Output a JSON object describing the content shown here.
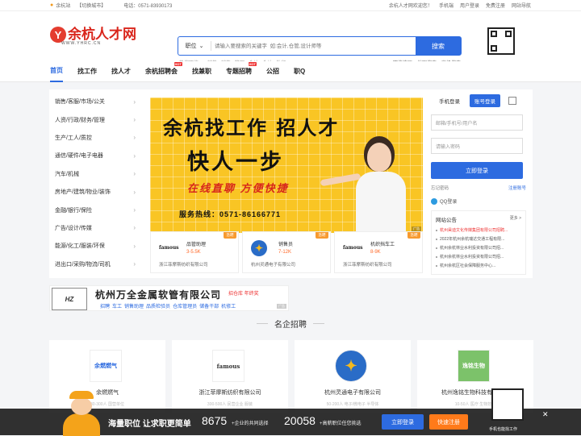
{
  "topbar": {
    "city": "余杭站",
    "switch": "【切换城市】",
    "phone": "电话：0571-83930173",
    "welcome": "余杭人才网欢迎您！",
    "mobile": "手机端",
    "login": "用户登录",
    "register": "免费注册",
    "sitenav": "网站导航"
  },
  "logo": {
    "text": "余杭人才网",
    "url": "WWW.YHRC.CN"
  },
  "search": {
    "type": "职位",
    "placeholder": "请输入要搜索的关键字  如:会计,仓管,设计师等",
    "button": "搜索",
    "hot_label": "热搜职位：",
    "hot": [
      "销售",
      "销售",
      "管理",
      "会计",
      "会计",
      "外贸"
    ],
    "quick": [
      "职位速历",
      "地图搜索",
      "高级搜索"
    ]
  },
  "nav": [
    {
      "label": "首页"
    },
    {
      "label": "找工作"
    },
    {
      "label": "找人才"
    },
    {
      "label": "余杭招聘会",
      "badge": "HOT"
    },
    {
      "label": "找兼职"
    },
    {
      "label": "专题招聘",
      "badge": "HOT"
    },
    {
      "label": "公招"
    },
    {
      "label": "职Q"
    }
  ],
  "cats": [
    "销售/客服/市场/公关",
    "人资/行政/财务/管理",
    "生产/工人/质控",
    "通信/硬件/电子电器",
    "汽车/机械",
    "房地产/建筑/物业/装饰",
    "金融/银行/保险",
    "广告/设计/传媒",
    "能源/化工/服装/环保",
    "进出口/采购/物流/司机"
  ],
  "banner": {
    "l1": "余杭找工作 招人才",
    "l2": "快人一步",
    "l3": "在线直聊 方便快捷",
    "l4": "服务热线：0571-86166771",
    "tag": "广告"
  },
  "jobs": [
    {
      "logo": "famous",
      "title": "品管助理",
      "salary": "3-5.5K",
      "company": "浙江菲摩斯纺织有限公司",
      "hot": "急聘"
    },
    {
      "logo": "✦",
      "title": "销售员",
      "salary": "7-12K",
      "company": "杭州灵通电子有限公司",
      "hot": "急聘"
    },
    {
      "logo": "famous",
      "title": "机织挡车工",
      "salary": "8-9K",
      "company": "浙江菲摩斯纺织有限公司",
      "hot": "急聘"
    }
  ],
  "login": {
    "tab1": "手机登录",
    "tab2": "账号登录",
    "user_ph": "邮箱/手机号/用户名",
    "pwd_ph": "请输入密码",
    "submit": "立即登录",
    "forgot": "忘记密码",
    "reg": "注册账号",
    "qq": "QQ登录"
  },
  "notice": {
    "title": "网站公告",
    "more": "更多 >",
    "items": [
      "杭州昊迪文化传媒集团有限公司招聘...",
      "2022年杭州余杭瑞达交通工程有限...",
      "杭州余杭林业水利投资有限公司招...",
      "杭州余杭林业水利投资有限公司招...",
      "杭州余杭区社会保障服务中心..."
    ]
  },
  "ad": {
    "logo": "HZ",
    "name": "杭州万全金属软管有限公司",
    "hiring": "招仓库  年终奖",
    "sub": [
      "招聘",
      "车工",
      "销售助理",
      "品质检验员",
      "仓库管理员",
      "储备干部",
      "机修工"
    ],
    "tag": "广告"
  },
  "section": {
    "title": "名企招聘"
  },
  "cards": [
    {
      "logo": "余燃燃气",
      "name": "余燃燃气",
      "sub": "30-300人  国营单位"
    },
    {
      "logo": "famous",
      "name": "浙江菲摩斯纺织有限公司",
      "sub": "300-500人  民营企业  服装"
    },
    {
      "logo": "✦",
      "name": "杭州灵通电子有限公司",
      "sub": "50-200人  电子/微电子  半导体"
    },
    {
      "logo": "逸铭生物",
      "name": "杭州逸铭生物科技有限公司",
      "sub": "10-50人  医疗  生物技术"
    }
  ],
  "footer": {
    "slogan": "海量职位 让求职更简单",
    "n1": "8675",
    "d1": "+企业的共同选择",
    "n2": "20058",
    "d2": "+高薪职位任您挑选",
    "login": "立即登录",
    "reg": "快速注册",
    "qrcap": "手机也能找工作",
    "close": "✕"
  },
  "colors": {
    "primary": "#2d6be0",
    "accent": "#ff7a1a",
    "logo_red": "#d9261c"
  }
}
